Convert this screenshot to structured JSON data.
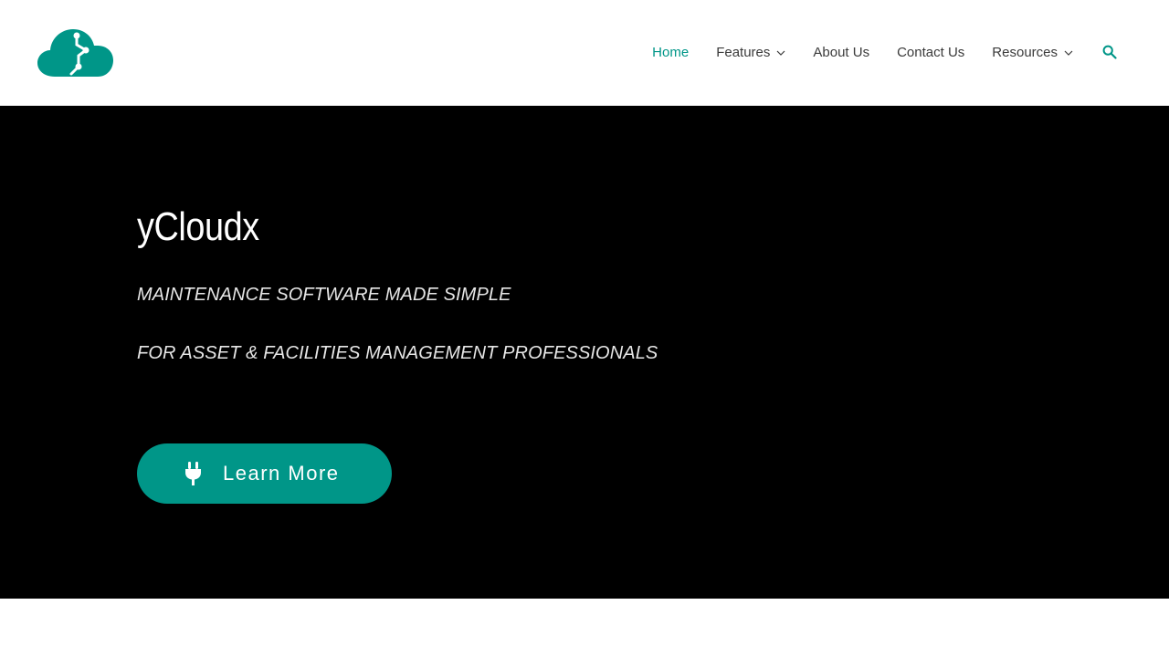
{
  "colors": {
    "accent": "#009688",
    "nav_text": "#3a3a3a",
    "hero_background": "#000000",
    "hero_text": "#ffffff"
  },
  "header": {
    "logo_icon": "cloud-logo-icon",
    "nav": [
      {
        "label": "Home",
        "active": true,
        "has_dropdown": false
      },
      {
        "label": "Features",
        "active": false,
        "has_dropdown": true
      },
      {
        "label": "About Us",
        "active": false,
        "has_dropdown": false
      },
      {
        "label": "Contact Us",
        "active": false,
        "has_dropdown": false
      },
      {
        "label": "Resources",
        "active": false,
        "has_dropdown": true
      }
    ],
    "search_icon": "search-icon"
  },
  "hero": {
    "title": "yCloudx",
    "subtitle_1": "MAINTENANCE SOFTWARE MADE SIMPLE",
    "subtitle_2": "FOR ASSET & FACILITIES MANAGEMENT PROFESSIONALS",
    "cta": {
      "label": "Learn More",
      "icon": "plug-icon"
    }
  }
}
